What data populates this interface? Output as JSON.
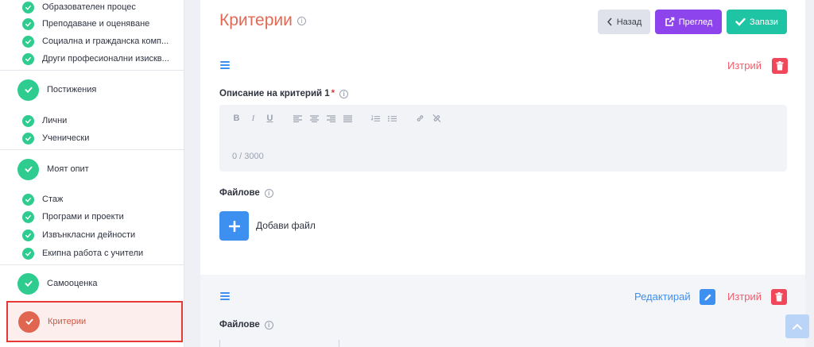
{
  "sidebar": {
    "sub_items_top": [
      "Образователен процес",
      "Преподаване и оценяване",
      "Социална и гражданска комп...",
      "Други професионални изискв..."
    ],
    "section_achievements": "Постижения",
    "sub_items_achievements": [
      "Лични",
      "Ученически"
    ],
    "section_experience": "Моят опит",
    "sub_items_experience": [
      "Стаж",
      "Програми и проекти",
      "Извънкласни дейности",
      "Екипна работа с учители"
    ],
    "section_self_assessment": "Самооценка",
    "section_criteria": "Критерии"
  },
  "header": {
    "title": "Критерии",
    "back_label": "Назад",
    "preview_label": "Преглед",
    "save_label": "Запази"
  },
  "criterion": {
    "delete_label": "Изтрий",
    "description_label": "Описание на критерий 1",
    "required_mark": "*",
    "char_counter": "0 / 3000",
    "files_label": "Файлове",
    "add_file_label": "Добави файл"
  },
  "criterion2": {
    "edit_label": "Редактирай",
    "delete_label": "Изтрий",
    "files_label": "Файлове"
  },
  "colors": {
    "accent_red": "#e06a55",
    "check_green": "#2ecc8f",
    "preview_purple": "#8e44ec",
    "save_teal": "#1ec4a3",
    "link_blue": "#3d8ff0",
    "delete_red": "#f0475a"
  }
}
